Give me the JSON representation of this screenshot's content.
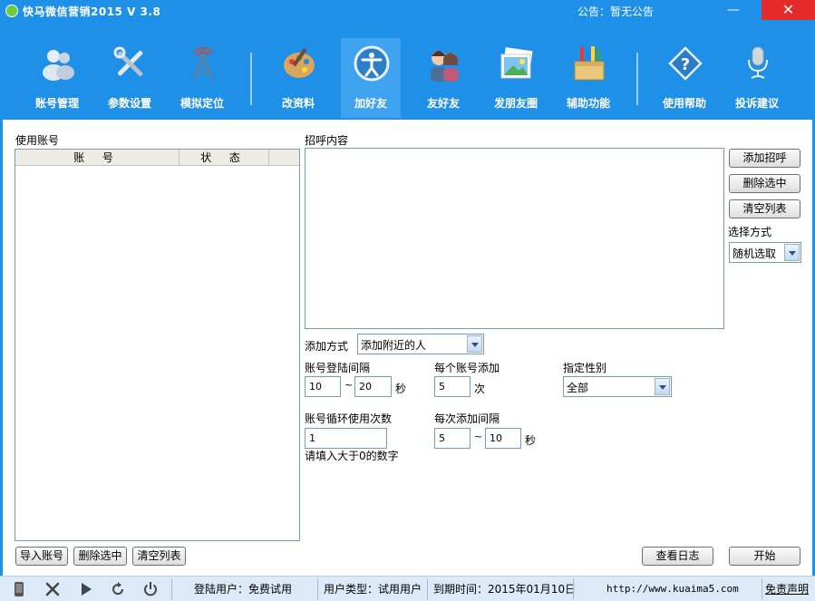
{
  "window": {
    "title": "快马微信营销2015  V 3.8",
    "notice": "公告：暂无公告",
    "minimize": "—",
    "maximize": "□",
    "close": "✕"
  },
  "toolbar": {
    "items": [
      {
        "label": "账号管理",
        "icon": "users-icon"
      },
      {
        "label": "参数设置",
        "icon": "tools-icon"
      },
      {
        "label": "模拟定位",
        "icon": "antenna-icon"
      },
      {
        "label": "改资料",
        "icon": "palette-icon"
      },
      {
        "label": "加好友",
        "icon": "person-add-icon",
        "active": true
      },
      {
        "label": "友好友",
        "icon": "couple-icon"
      },
      {
        "label": "发朋友圈",
        "icon": "photos-icon"
      },
      {
        "label": "辅助功能",
        "icon": "toolbox-icon"
      },
      {
        "label": "使用帮助",
        "icon": "help-icon"
      },
      {
        "label": "投诉建议",
        "icon": "microphone-icon"
      }
    ]
  },
  "accounts": {
    "title": "使用账号",
    "columns": [
      "账 号",
      "状 态"
    ],
    "rows": [],
    "buttons": {
      "import": "导入账号",
      "delete": "删除选中",
      "clear": "清空列表"
    }
  },
  "greeting": {
    "title": "招呼内容",
    "value": "",
    "buttons": {
      "add": "添加招呼",
      "delete": "删除选中",
      "clear": "清空列表"
    },
    "select_mode_label": "选择方式",
    "select_mode_value": "随机选取"
  },
  "options": {
    "add_method_label": "添加方式",
    "add_method_value": "添加附近的人",
    "login_interval_label": "账号登陆间隔",
    "login_interval_min": "10",
    "login_interval_max": "20",
    "sec_unit": "秒",
    "per_account_label": "每个账号添加",
    "per_account_value": "5",
    "times_unit": "次",
    "gender_label": "指定性别",
    "gender_value": "全部",
    "loop_label": "账号循环使用次数",
    "loop_value": "1",
    "loop_hint": "请填入大于0的数字",
    "add_interval_label": "每次添加间隔",
    "add_interval_min": "5",
    "add_interval_max": "10",
    "tilde": "~"
  },
  "actions": {
    "view_log": "查看日志",
    "start": "开始"
  },
  "status": {
    "login_user": "登陆用户：免费试用",
    "user_type": "用户类型：试用用户",
    "expire": "到期时间：2015年01月10日",
    "url": "http://www.kuaima5.com",
    "disclaimer": "免责声明"
  }
}
